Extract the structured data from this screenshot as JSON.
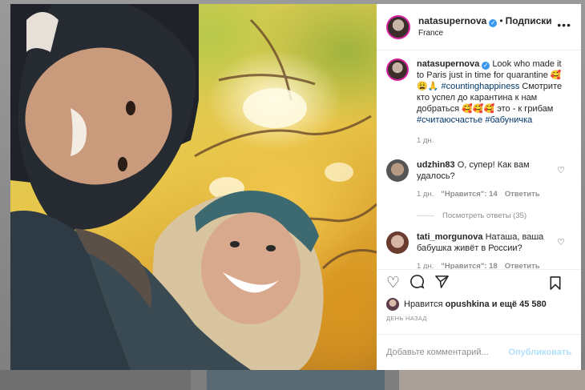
{
  "post": {
    "username": "natasupernova",
    "follow_label": "Подписки",
    "location": "France",
    "more_icon": "•••"
  },
  "caption": {
    "username": "natasupernova",
    "text_1": "Look who made it to Paris just in time for quarantine 🥰😩🙏",
    "tag_1": "#countinghappiness",
    "text_2": "Смотрите кто успел до карантина к нам добраться 🥰🥰🥰 это - к грибам",
    "tag_2": "#считаюсчастье",
    "tag_3": "#бабуничка",
    "time": "1 дн."
  },
  "comments": [
    {
      "username": "udzhin83",
      "text": "О, супер! Как вам удалось?",
      "time": "1 дн.",
      "likes": "\"Нравится\": 14",
      "reply": "Ответить"
    },
    {
      "username": "tati_morgunova",
      "text": "Наташа, ваша бабушка живёт в России?",
      "time": "1 дн.",
      "likes": "\"Нравится\": 18",
      "reply": "Ответить"
    }
  ],
  "view_replies": "Посмотреть ответы (35)",
  "likes_line": {
    "prefix": "Нравится",
    "user": "opushkina",
    "connector": "и ещё",
    "count": "45 580"
  },
  "date": "ДЕНЬ НАЗАД",
  "add_comment": {
    "placeholder": "Добавьте комментарий...",
    "publish": "Опубликовать"
  }
}
